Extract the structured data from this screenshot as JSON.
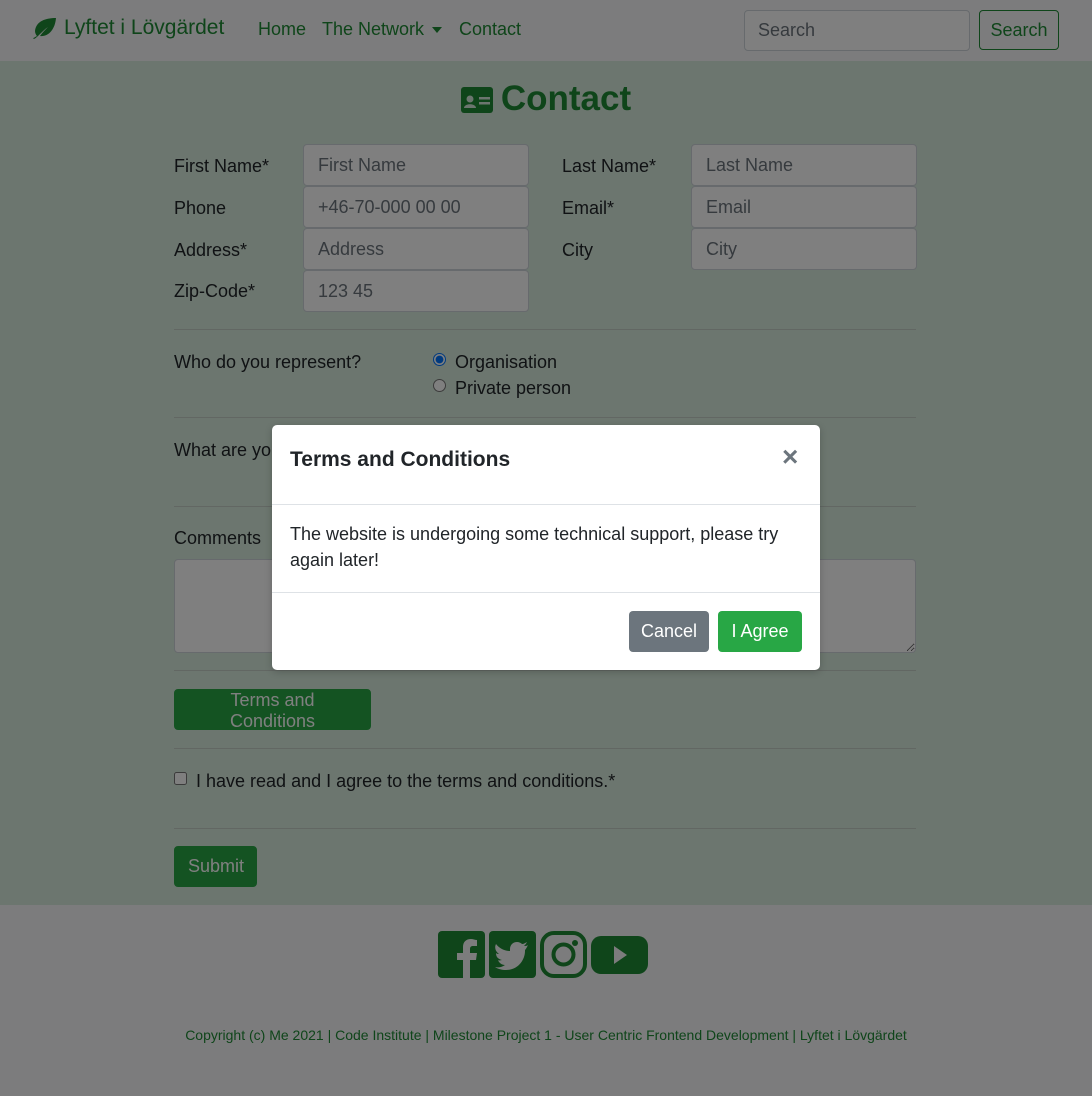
{
  "navbar": {
    "brand": "Lyftet i Lövgärdet",
    "links": {
      "home": "Home",
      "network": "The Network",
      "contact": "Contact"
    },
    "search_placeholder": "Search",
    "search_button": "Search"
  },
  "contact": {
    "heading": "Contact",
    "fields": {
      "first_name": {
        "label": "First Name*",
        "placeholder": "First Name"
      },
      "last_name": {
        "label": "Last Name*",
        "placeholder": "Last Name"
      },
      "phone": {
        "label": "Phone",
        "placeholder": "+46-70-000 00 00"
      },
      "email": {
        "label": "Email*",
        "placeholder": "Email"
      },
      "address": {
        "label": "Address*",
        "placeholder": "Address"
      },
      "city": {
        "label": "City",
        "placeholder": "City"
      },
      "zip": {
        "label": "Zip-Code*",
        "placeholder": "123 45"
      }
    },
    "represent": {
      "question": "Who do you represent?",
      "options": [
        "Organisation",
        "Private person"
      ],
      "selected": "Organisation"
    },
    "interest_question_partial": "What are you",
    "comments_label": "Comments",
    "terms_button": "Terms and Conditions",
    "agree_label": "I have read and I agree to the terms and conditions.*",
    "agree_checked": false,
    "submit_button": "Submit"
  },
  "footer": {
    "social_icons": [
      "facebook-icon",
      "twitter-icon",
      "instagram-icon",
      "youtube-icon"
    ],
    "copyright": "Copyright (c) Me 2021 | Code Institute | Milestone Project 1 - User Centric Frontend Development | Lyftet i Lövgärdet"
  },
  "modal": {
    "title": "Terms and Conditions",
    "close_symbol": "×",
    "body": "The website is undergoing some technical support, please try again later!",
    "cancel_button": "Cancel",
    "agree_button": "I Agree"
  },
  "colors": {
    "brand_green": "#1e8a34",
    "button_green": "#28a745",
    "cancel_gray": "#6c757d",
    "main_background": "#d9ecde"
  }
}
